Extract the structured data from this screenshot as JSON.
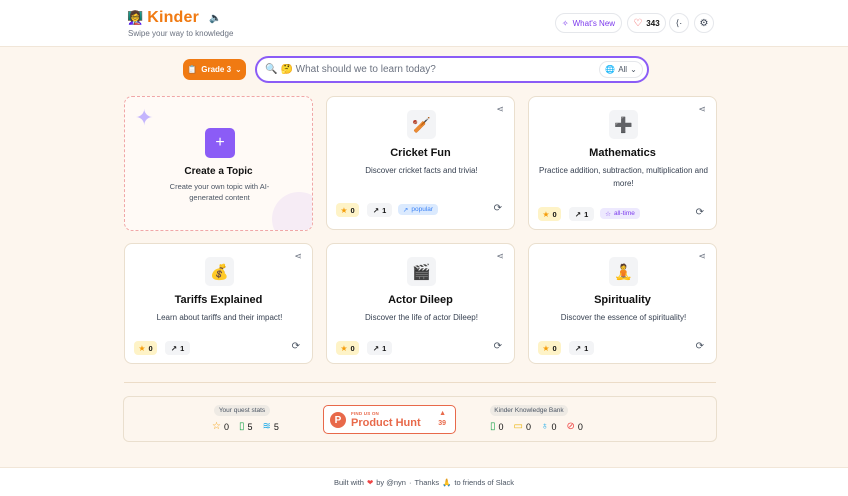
{
  "header": {
    "logo_emoji": "👩‍🏫",
    "brand": "Kinder",
    "tagline": "Swipe your way to knowledge",
    "whats_new": "What's New",
    "likes": "343"
  },
  "search": {
    "grade_label": "Grade 3",
    "placeholder": "🤔 What should we to learn today?",
    "filter_label": "All"
  },
  "create_card": {
    "title": "Create a Topic",
    "description": "Create your own topic with AI-generated content"
  },
  "topics": [
    {
      "emoji": "🏏",
      "title": "Cricket Fun",
      "description": "Discover cricket facts and trivia!",
      "stars": "0",
      "trend": "1",
      "tag": "popular"
    },
    {
      "emoji": "➕",
      "title": "Mathematics",
      "description": "Practice addition, subtraction, multiplication and more!",
      "stars": "0",
      "trend": "1",
      "tag": "all-time"
    },
    {
      "emoji": "💰",
      "title": "Tariffs Explained",
      "description": "Learn about tariffs and their impact!",
      "stars": "0",
      "trend": "1",
      "tag": ""
    },
    {
      "emoji": "🎬",
      "title": "Actor Dileep",
      "description": "Discover the life of actor Dileep!",
      "stars": "0",
      "trend": "1",
      "tag": ""
    },
    {
      "emoji": "🧘",
      "title": "Spirituality",
      "description": "Discover the essence of spirituality!",
      "stars": "0",
      "trend": "1",
      "tag": ""
    }
  ],
  "quest_stats": {
    "label": "Your quest stats",
    "stars": "0",
    "books": "5",
    "layers": "5"
  },
  "product_hunt": {
    "find_us": "FIND US ON",
    "name": "Product Hunt",
    "count": "39"
  },
  "knowledge_bank": {
    "label": "Kinder Knowledge Bank",
    "books": "0",
    "comments": "0",
    "awards": "0",
    "checks": "0"
  },
  "footer": {
    "built_with": "Built with",
    "by": "by @nyn",
    "sep": "·",
    "thanks": "Thanks",
    "friends": "to friends of Slack"
  },
  "colors": {
    "accent": "#f07a12",
    "purple": "#8b5cf6",
    "background": "#fdf6ee"
  }
}
